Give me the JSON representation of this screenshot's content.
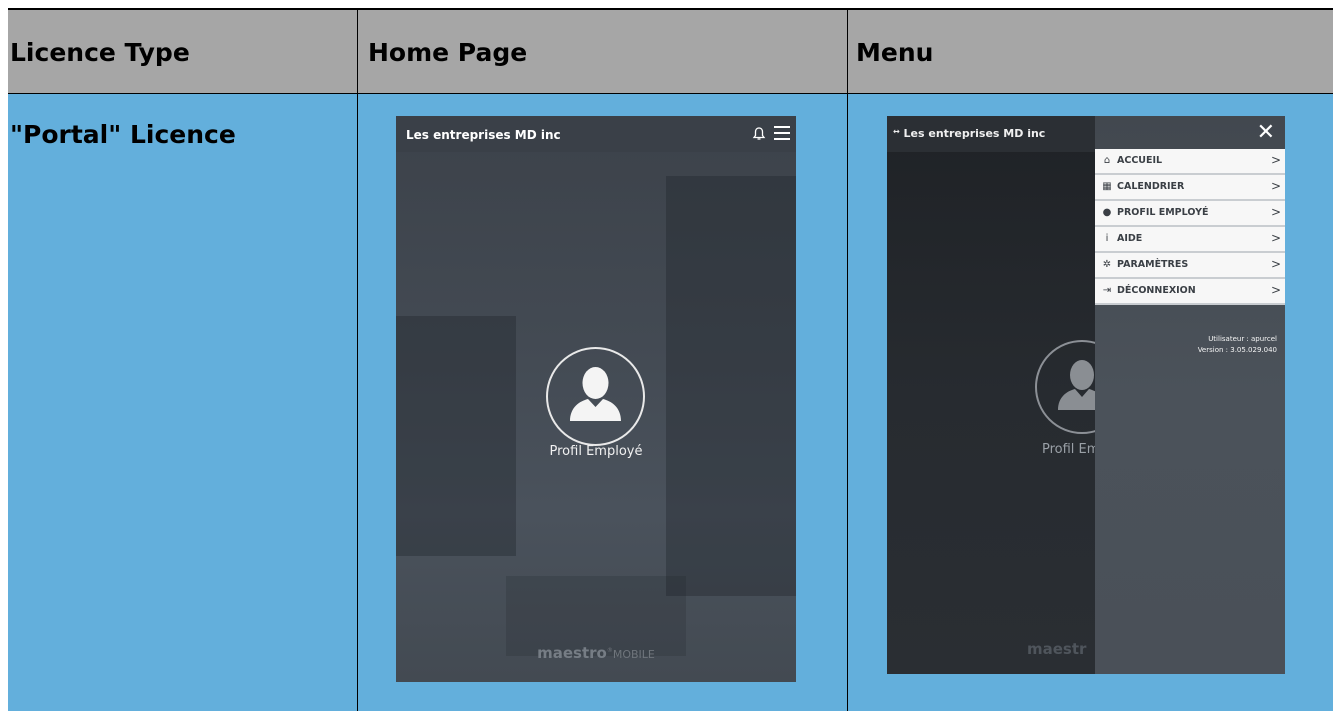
{
  "headers": [
    "Licence Type",
    "Home Page",
    "Menu"
  ],
  "licence": "\"Portal\" Licence",
  "home": {
    "title": "Les entreprises MD inc",
    "profile_label": "Profil Employé",
    "brand_bold": "maestro",
    "brand_light": "MOBILE"
  },
  "menu": {
    "title": "Les entreprises MD inc",
    "close": "✕",
    "profile_label_partial": "Profil Em",
    "brand_partial": "maestr",
    "items": [
      {
        "label": "ACCUEIL",
        "icon": "home-icon",
        "glyph": "⌂"
      },
      {
        "label": "CALENDRIER",
        "icon": "calendar-icon",
        "glyph": "▦"
      },
      {
        "label": "PROFIL EMPLOYÉ",
        "icon": "user-icon",
        "glyph": "●"
      },
      {
        "label": "AIDE",
        "icon": "info-icon",
        "glyph": "i"
      },
      {
        "label": "PARAMÈTRES",
        "icon": "gear-icon",
        "glyph": "✲"
      },
      {
        "label": "DÉCONNEXION",
        "icon": "logout-icon",
        "glyph": "⇥"
      }
    ],
    "arrow": ">",
    "user": "Utilisateur : apurcel",
    "version": "Version : 3.05.029.040"
  }
}
